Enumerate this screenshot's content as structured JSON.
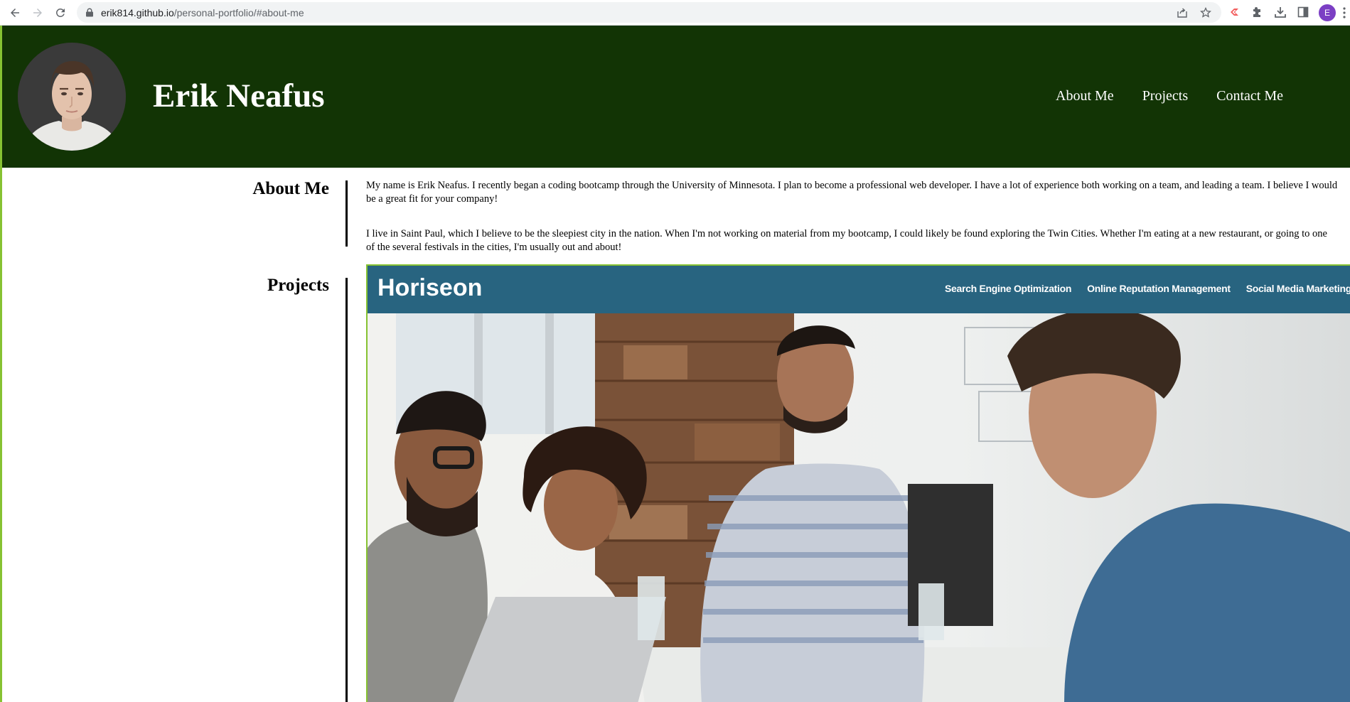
{
  "browser": {
    "url_host": "erik814.github.io",
    "url_path": "/personal-portfolio/#about-me",
    "profile_initial": "E"
  },
  "header": {
    "name": "Erik Neafus",
    "nav": [
      "About Me",
      "Projects",
      "Contact Me"
    ]
  },
  "about": {
    "title": "About Me",
    "paragraphs": [
      "My name is Erik Neafus. I recently began a coding bootcamp through the University of Minnesota. I plan to become a professional web developer. I have a lot of experience both working on a team, and leading a team. I believe I would be a great fit for your company!",
      "I live in Saint Paul, which I believe to be the sleepiest city in the nation. When I'm not working on material from my bootcamp, I could likely be found exploring the Twin Cities. Whether I'm eating at a new restaurant, or going to one of the several festivals in the cities, I'm usually out and about!"
    ]
  },
  "projects": {
    "title": "Projects",
    "preview": {
      "logo": "Horiseon",
      "nav": [
        "Search Engine Optimization",
        "Online Reputation Management",
        "Social Media Marketing"
      ]
    }
  },
  "colors": {
    "header_bg": "#123405",
    "accent_green": "#86c232",
    "horiseon_bar": "#286480"
  }
}
